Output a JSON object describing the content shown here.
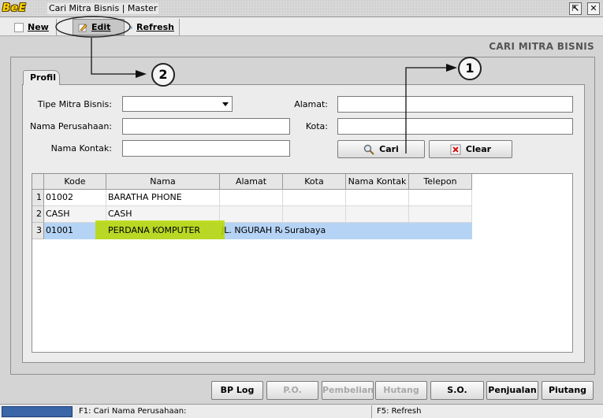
{
  "window": {
    "logo_text": "BeE",
    "title": "Cari Mitra Bisnis | Master",
    "minimize_glyph": "⇱",
    "close_glyph": "✕"
  },
  "toolbar": {
    "new_label": "New",
    "edit_label": "Edit",
    "refresh_label": "Refresh"
  },
  "page": {
    "heading": "CARI MITRA BISNIS"
  },
  "tabs": [
    {
      "label": "Profil",
      "active": true
    }
  ],
  "form": {
    "tipe_label": "Tipe Mitra Bisnis:",
    "tipe_value": "",
    "nama_perusahaan_label": "Nama Perusahaan:",
    "nama_perusahaan_value": "",
    "nama_kontak_label": "Nama Kontak:",
    "nama_kontak_value": "",
    "alamat_label": "Alamat:",
    "alamat_value": "",
    "kota_label": "Kota:",
    "kota_value": "",
    "cari_label": "Cari",
    "clear_label": "Clear"
  },
  "grid": {
    "columns": [
      "Kode",
      "Nama",
      "Alamat",
      "Kota",
      "Nama Kontak",
      "Telepon"
    ],
    "rows": [
      {
        "num": "1",
        "kode": "01002",
        "nama": "BARATHA PHONE",
        "alamat": "",
        "kota": "",
        "kontak": "",
        "telepon": "",
        "selected": false
      },
      {
        "num": "2",
        "kode": "CASH",
        "nama": "CASH",
        "alamat": "",
        "kota": "",
        "kontak": "",
        "telepon": "",
        "selected": false
      },
      {
        "num": "3",
        "kode": "01001",
        "nama": "PERDANA KOMPUTER",
        "alamat": "JL. NGURAH RA",
        "kota": "Surabaya",
        "kontak": "",
        "telepon": "",
        "selected": true
      }
    ]
  },
  "annotations": {
    "step1": "1",
    "step2": "2",
    "highlight_color": "#b8d800"
  },
  "bottom_buttons": [
    {
      "label": "BP Log",
      "enabled": true
    },
    {
      "label": "P.O.",
      "enabled": false
    },
    {
      "label": "Pembelian",
      "enabled": false
    },
    {
      "label": "Hutang",
      "enabled": false
    },
    {
      "label": "S.O.",
      "enabled": true
    },
    {
      "label": "Penjualan",
      "enabled": true
    },
    {
      "label": "Piutang",
      "enabled": true
    }
  ],
  "status": {
    "hint_f1": "F1: Cari Nama Perusahaan:",
    "hint_f5": "F5: Refresh"
  },
  "colors": {
    "selected_row": "#b5d3f5",
    "status_progress": "#3a66a8"
  }
}
